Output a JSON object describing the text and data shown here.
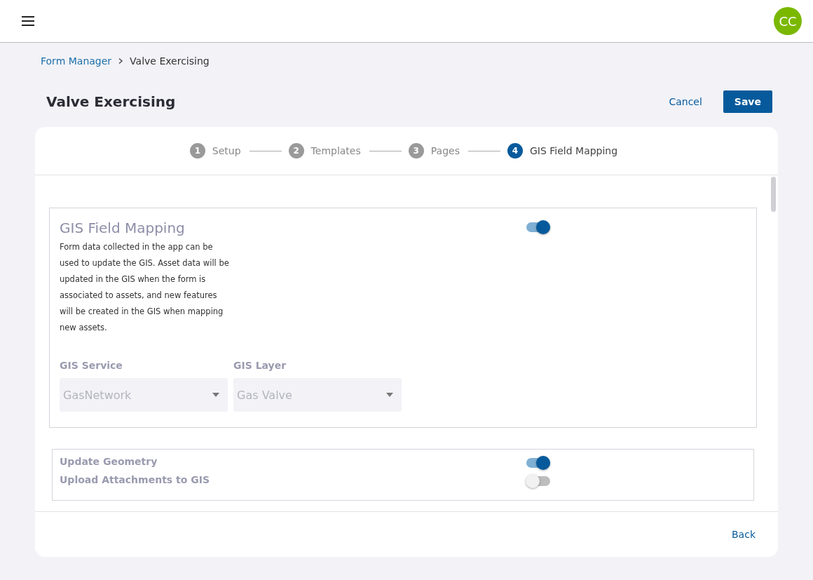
{
  "header": {
    "avatar": "CC"
  },
  "breadcrumb": {
    "parent": "Form Manager",
    "current": "Valve Exercising"
  },
  "page": {
    "title": "Valve Exercising",
    "cancel": "Cancel",
    "save": "Save"
  },
  "steps": [
    {
      "number": "1",
      "label": "Setup",
      "selected": false
    },
    {
      "number": "2",
      "label": "Templates",
      "selected": false
    },
    {
      "number": "3",
      "label": "Pages",
      "selected": false
    },
    {
      "number": "4",
      "label": "GIS Field Mapping",
      "selected": true
    }
  ],
  "mapping": {
    "title": "GIS Field Mapping",
    "on": true,
    "description": "Form data collected in the app can be used to update the GIS. Asset data will be updated in the GIS when the form is associated to assets, and new features will be created in the GIS when mapping new assets.",
    "fields": [
      {
        "label": "GIS Service",
        "value": "GasNetwork"
      },
      {
        "label": "GIS Layer",
        "value": "Gas Valve"
      }
    ]
  },
  "options": [
    {
      "label": "Update Geometry",
      "on": true
    },
    {
      "label": "Upload Attachments to GIS",
      "on": false
    }
  ],
  "footer": {
    "back": "Back"
  }
}
